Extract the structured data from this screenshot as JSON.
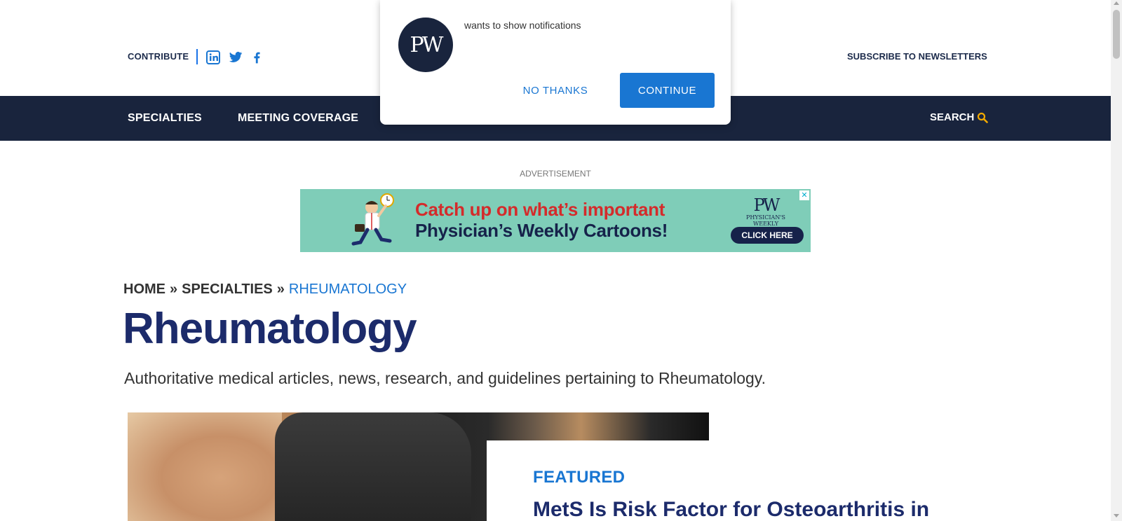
{
  "header": {
    "contribute_label": "CONTRIBUTE",
    "social_icons": [
      "linkedin-icon",
      "twitter-icon",
      "facebook-icon"
    ],
    "subscribe_label": "SUBSCRIBE TO NEWSLETTERS"
  },
  "nav": {
    "items": [
      {
        "label": "SPECIALTIES"
      },
      {
        "label": "MEETING COVERAGE"
      }
    ],
    "search_label": "SEARCH",
    "search_icon": "search-icon",
    "accent_color": "#f2a900",
    "background_color": "#19243d"
  },
  "notification_popup": {
    "logo_text": "PW",
    "message": "wants to show notifications",
    "no_thanks_label": "NO THANKS",
    "continue_label": "CONTINUE",
    "button_color": "#1976d2"
  },
  "advertisement": {
    "label": "ADVERTISEMENT",
    "close_glyph": "✕",
    "headline": "Catch up on what’s important",
    "subheadline": "Physician’s Weekly Cartoons!",
    "brand_mark": "PW",
    "brand_name": "PHYSICIAN'S WEEKLY",
    "cta_label": "CLICK HERE"
  },
  "breadcrumb": {
    "items": [
      "HOME",
      "»",
      "SPECIALTIES",
      "»"
    ],
    "current": "RHEUMATOLOGY"
  },
  "page": {
    "title": "Rheumatology",
    "description": "Authoritative medical articles, news, research, and guidelines pertaining to Rheumatology."
  },
  "featured": {
    "label": "FEATURED",
    "title": "MetS Is Risk Factor for Osteoarthritis in"
  }
}
